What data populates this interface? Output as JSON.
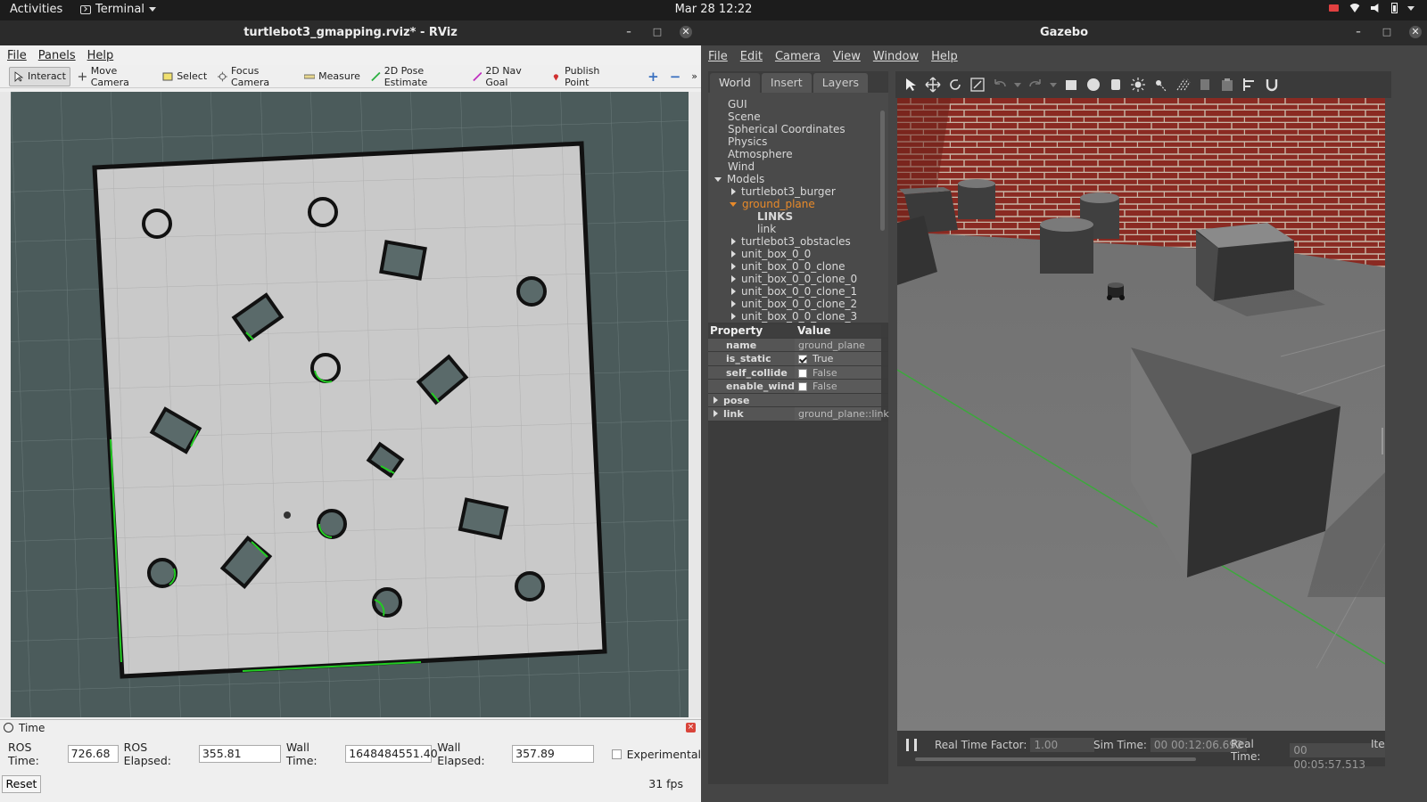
{
  "topbar": {
    "activities": "Activities",
    "app_menu": "Terminal",
    "clock": "Mar 28  12:22"
  },
  "rviz": {
    "title": "turtlebot3_gmapping.rviz* - RViz",
    "menu": [
      "File",
      "Panels",
      "Help"
    ],
    "tools": [
      "Interact",
      "Move Camera",
      "Select",
      "Focus Camera",
      "Measure",
      "2D Pose Estimate",
      "2D Nav Goal",
      "Publish Point"
    ],
    "time_panel": {
      "title": "Time",
      "ros_time_label": "ROS Time:",
      "ros_time": "726.68",
      "ros_elapsed_label": "ROS Elapsed:",
      "ros_elapsed": "355.81",
      "wall_time_label": "Wall Time:",
      "wall_time": "1648484551.40",
      "wall_elapsed_label": "Wall Elapsed:",
      "wall_elapsed": "357.89",
      "experimental_label": "Experimental",
      "reset_label": "Reset",
      "fps": "31 fps"
    },
    "colors": {
      "map_bg": "#4b5b5b",
      "free_space": "#c8c8c8",
      "occupied": "#111111",
      "scan": "#22cc22",
      "obstacle_fill": "#5a6a6a"
    }
  },
  "gazebo": {
    "title": "Gazebo",
    "menu": [
      "File",
      "Edit",
      "Camera",
      "View",
      "Window",
      "Help"
    ],
    "tabs": [
      "World",
      "Insert",
      "Layers"
    ],
    "tree": [
      "GUI",
      "Scene",
      "Spherical Coordinates",
      "Physics",
      "Atmosphere",
      "Wind",
      "Models",
      "turtlebot3_burger",
      "ground_plane",
      "LINKS",
      "link",
      "turtlebot3_obstacles",
      "unit_box_0_0",
      "unit_box_0_0_clone",
      "unit_box_0_0_clone_0",
      "unit_box_0_0_clone_1",
      "unit_box_0_0_clone_2",
      "unit_box_0_0_clone_3"
    ],
    "props": {
      "h_property": "Property",
      "h_value": "Value",
      "name_k": "name",
      "name_v": "ground_plane",
      "static_k": "is_static",
      "static_v": "True",
      "collide_k": "self_collide",
      "collide_v": "False",
      "wind_k": "enable_wind",
      "wind_v": "False",
      "pose_k": "pose",
      "link_k": "link",
      "link_v": "ground_plane::link"
    },
    "bottom": {
      "rtf_label": "Real Time Factor:",
      "rtf": "1.00",
      "sim_label": "Sim Time:",
      "sim": "00 00:12:06.692",
      "real_label": "Real Time:",
      "real": "00 00:05:57.513",
      "iter_label": "Ite"
    },
    "colors": {
      "selected": "#e88a2a",
      "wall_brick": "#8a2a22"
    }
  }
}
